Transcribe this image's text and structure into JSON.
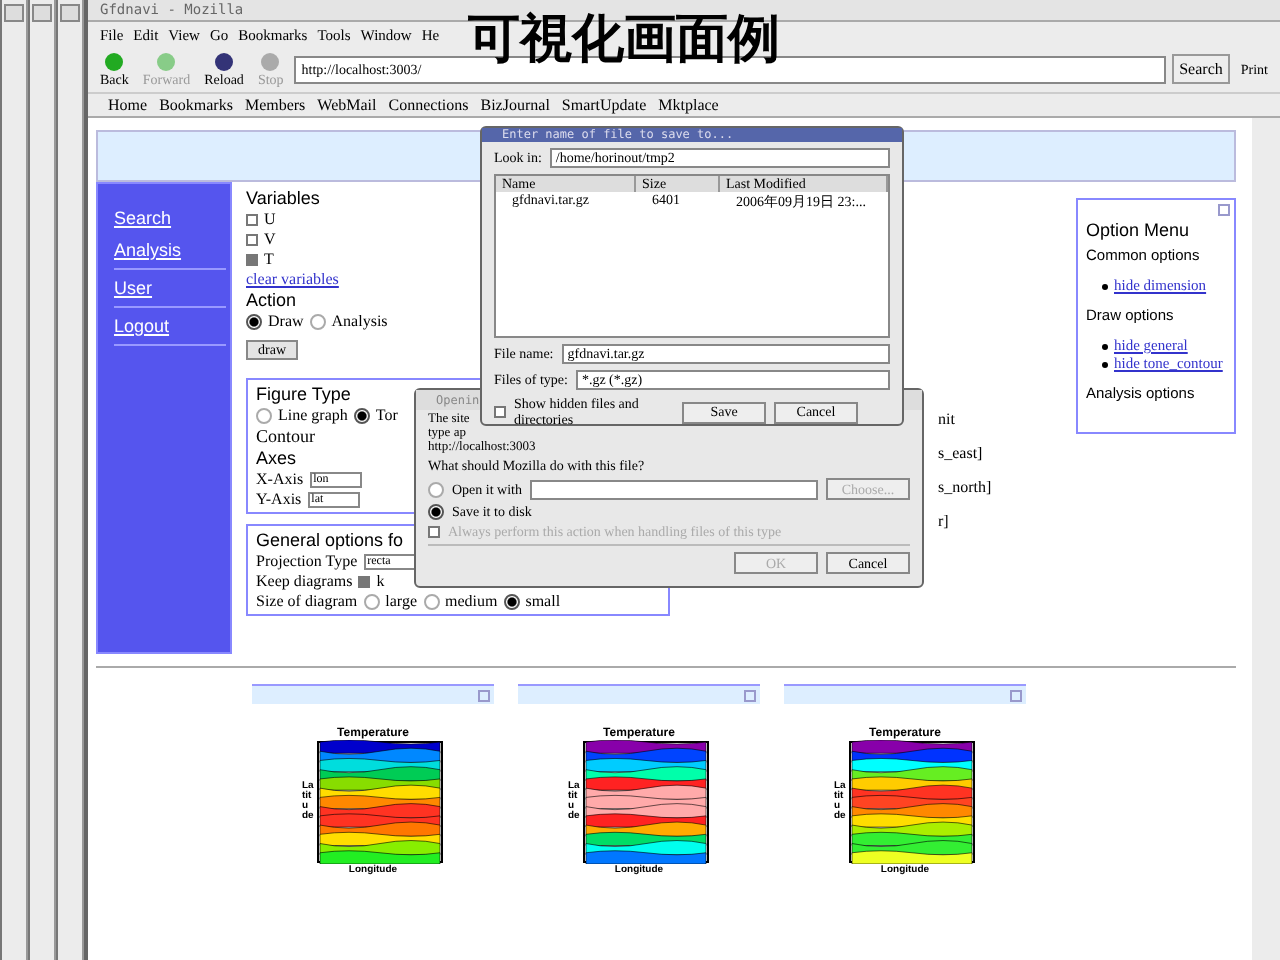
{
  "window": {
    "title": "Gfdnavi - Mozilla"
  },
  "menu": [
    "File",
    "Edit",
    "View",
    "Go",
    "Bookmarks",
    "Tools",
    "Window",
    "He"
  ],
  "toolbar": [
    {
      "label": "Back",
      "disabled": false,
      "kind": "back"
    },
    {
      "label": "Forward",
      "disabled": true,
      "kind": "forward"
    },
    {
      "label": "Reload",
      "disabled": false,
      "kind": "reload"
    },
    {
      "label": "Stop",
      "disabled": true,
      "kind": "stop"
    }
  ],
  "url": "http://localhost:3003/",
  "search_button": "Search",
  "print_button": "Print",
  "bookmarks": [
    "Home",
    "Bookmarks",
    "Members",
    "WebMail",
    "Connections",
    "BizJournal",
    "SmartUpdate",
    "Mktplace"
  ],
  "overlay_title": "可視化画面例",
  "sidebar": {
    "groups": [
      [
        "Search",
        "Analysis"
      ],
      [
        "User"
      ],
      [
        "Logout"
      ]
    ]
  },
  "variables": {
    "heading": "Variables",
    "items": [
      {
        "label": "U",
        "checked": false
      },
      {
        "label": "V",
        "checked": false
      },
      {
        "label": "T",
        "checked": true
      }
    ],
    "clear_link": "clear variables"
  },
  "action": {
    "heading": "Action",
    "options": [
      {
        "label": "Draw",
        "selected": true
      },
      {
        "label": "Analysis",
        "selected": false
      }
    ],
    "button": "draw"
  },
  "figure_type": {
    "heading": "Figure Type",
    "options": [
      {
        "label": "Line graph",
        "selected": false
      },
      {
        "label": "Tor",
        "selected": true
      }
    ],
    "continuation": "Contour"
  },
  "axes": {
    "heading": "Axes",
    "items": [
      {
        "label": "X-Axis",
        "value": "lon"
      },
      {
        "label": "Y-Axis",
        "value": "lat"
      }
    ]
  },
  "side_fragments": [
    "nit",
    "s_east]",
    "s_north]",
    "r]"
  ],
  "general_options": {
    "heading": "General options fo",
    "projection_label": "Projection Type",
    "projection_value": "recta",
    "keep_label": "Keep diagrams",
    "keep_checked": true,
    "keep_text": "k",
    "size_label": "Size of diagram",
    "sizes": [
      {
        "label": "large",
        "selected": false
      },
      {
        "label": "medium",
        "selected": false
      },
      {
        "label": "small",
        "selected": true
      }
    ]
  },
  "option_menu": {
    "title": "Option Menu",
    "sections": [
      {
        "heading": "Common options",
        "links": [
          "hide dimension"
        ]
      },
      {
        "heading": "Draw options",
        "links": [
          "hide general",
          "hide tone_contour"
        ]
      },
      {
        "heading": "Analysis options"
      }
    ]
  },
  "save_dialog": {
    "title": "Enter name of file to save to...",
    "look_in_label": "Look in:",
    "look_in": "/home/horinout/tmp2",
    "columns": [
      "Name",
      "Size",
      "Last Modified"
    ],
    "rows": [
      [
        "gfdnavi.tar.gz",
        "6401",
        "2006年09月19日 23:..."
      ]
    ],
    "file_name_label": "File name:",
    "file_name": "gfdnavi.tar.gz",
    "file_type_label": "Files of type:",
    "file_type": "*.gz (*.gz)",
    "show_hidden": {
      "label": "Show hidden files and directories",
      "checked": false
    },
    "buttons": [
      "Save",
      "Cancel"
    ]
  },
  "open_dialog": {
    "title": "Openin",
    "lines": [
      "The site",
      "type ap",
      "http://localhost:3003"
    ],
    "question": "What should Mozilla do with this file?",
    "options": [
      {
        "label": "Open it with",
        "selected": false
      },
      {
        "label": "Save it to disk",
        "selected": true
      }
    ],
    "choose_button": "Choose...",
    "always": {
      "label": "Always perform this action when handling files of this type",
      "checked": false,
      "disabled": true
    },
    "buttons": [
      {
        "label": "OK",
        "disabled": true
      },
      {
        "label": "Cancel",
        "disabled": false
      }
    ]
  },
  "plots": [
    {
      "title": "Temperature",
      "xlabel": "Longitude",
      "ylabel": "Latitude",
      "kind": "a"
    },
    {
      "title": "Temperature",
      "xlabel": "Longitude",
      "ylabel": "Latitude",
      "kind": "b"
    },
    {
      "title": "Temperature",
      "xlabel": "Longitude",
      "ylabel": "Latitude",
      "kind": "c"
    }
  ]
}
